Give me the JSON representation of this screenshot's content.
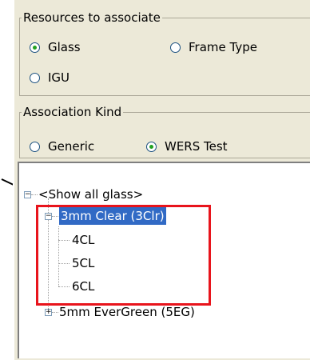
{
  "resources": {
    "title": "Resources to associate",
    "options": {
      "glass": "Glass",
      "frame_type": "Frame Type",
      "igu": "IGU"
    },
    "selected": "Glass"
  },
  "association": {
    "title": "Association Kind",
    "options": {
      "generic": "Generic",
      "wers_test": "WERS Test"
    },
    "selected": "WERS Test"
  },
  "tree": {
    "root": "<Show all glass>",
    "clear_node": "3mm Clear (3Clr)",
    "children": [
      "4CL",
      "5CL",
      "6CL"
    ],
    "evergreen_node": "5mm EverGreen (5EG)"
  },
  "colors": {
    "selection": "#316ac5",
    "highlight": "#e8141c",
    "radio_check": "#21a121"
  }
}
